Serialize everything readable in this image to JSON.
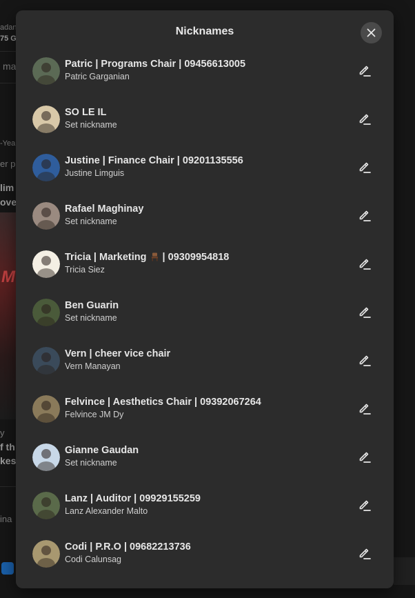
{
  "dialog": {
    "title": "Nicknames",
    "close_icon": "close-icon"
  },
  "members": [
    {
      "nickname": "Patric | Programs Chair | 09456613005",
      "subtitle": "Patric Garganian",
      "avatar_color": "#5b6a55"
    },
    {
      "nickname": "SO LE IL",
      "subtitle": "Set nickname",
      "avatar_color": "#d8c8a8"
    },
    {
      "nickname": "Justine | Finance Chair | 09201135556",
      "subtitle": "Justine Limguis",
      "avatar_color": "#2f5d9c"
    },
    {
      "nickname": "Rafael Maghinay",
      "subtitle": "Set nickname",
      "avatar_color": "#9a8a80"
    },
    {
      "nickname_before": "Tricia | Marketing ",
      "nickname_icon": "chair-icon",
      "nickname_after": " | 09309954818",
      "subtitle": "Tricia Siez",
      "avatar_color": "#f4efe4"
    },
    {
      "nickname": "Ben Guarin",
      "subtitle": "Set nickname",
      "avatar_color": "#4a5a3a"
    },
    {
      "nickname": "Vern | cheer vice chair",
      "subtitle": "Vern Manayan",
      "avatar_color": "#3a4a5a"
    },
    {
      "nickname": "Felvince | Aesthetics Chair | 09392067264",
      "subtitle": "Felvince JM Dy",
      "avatar_color": "#8a7a5a"
    },
    {
      "nickname": "Gianne Gaudan",
      "subtitle": "Set nickname",
      "avatar_color": "#c8d8e8"
    },
    {
      "nickname": "Lanz | Auditor | 09929155259",
      "subtitle": "Lanz Alexander Malto",
      "avatar_color": "#5a6a4a"
    },
    {
      "nickname": "Codi | P.R.O | 09682213736",
      "subtitle": "Codi Calunsag",
      "avatar_color": "#a89870"
    }
  ],
  "icons": {
    "edit": "pencil-edit-icon"
  },
  "background": {
    "fragments": [
      "adan",
      "75 G",
      "ma",
      "-Yea",
      "er pl",
      "lim",
      "ove",
      "M",
      "y",
      "f th",
      "kes",
      "ina"
    ]
  }
}
